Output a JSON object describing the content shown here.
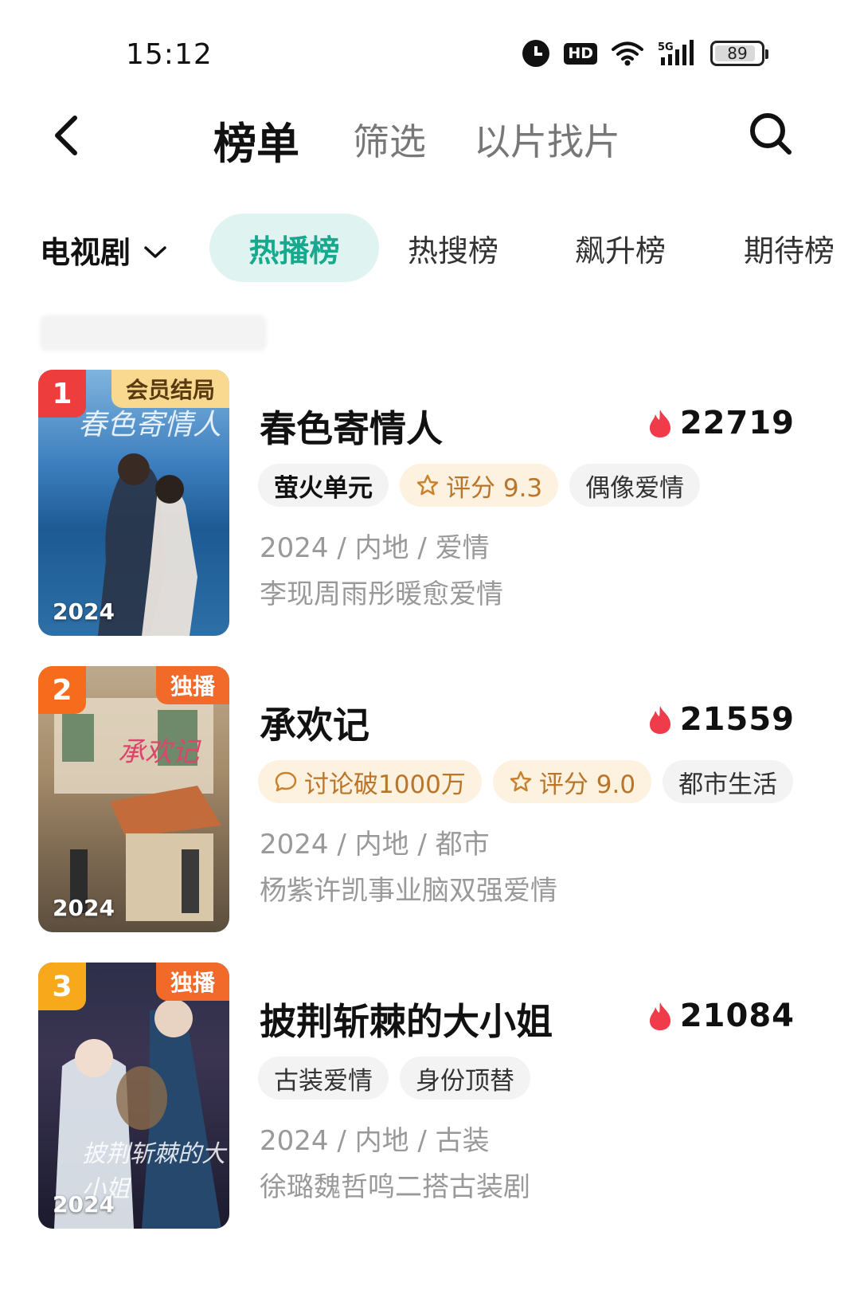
{
  "status_bar": {
    "time": "15:12",
    "battery": "89",
    "battery_level": 0.89,
    "icons": [
      "alarm-icon",
      "hd-icon",
      "wifi-icon",
      "signal-5g-icon",
      "battery-icon"
    ],
    "hd_label": "HD",
    "network_label": "5G"
  },
  "header": {
    "tab_active": "榜单",
    "tab_filter": "筛选",
    "tab_image_search": "以片找片",
    "back_icon": "chevron-left-icon",
    "search_icon": "search-icon"
  },
  "category": {
    "selected": "电视剧",
    "pills": [
      "热播榜",
      "热搜榜",
      "飙升榜",
      "期待榜"
    ],
    "active_index": 0
  },
  "colors": {
    "accent": "#17a98e",
    "accent_bg": "#dff4f1",
    "heat": "#ef3b4a",
    "warm_tag_bg": "#fdf1df",
    "warm_tag_text": "#b9762a",
    "rank1": "#ee3d3d",
    "rank2": "#f76b1c",
    "rank3": "#f7a81b"
  },
  "items": [
    {
      "rank": "1",
      "corner_tag": "会员结局",
      "poster_year": "2024",
      "title": "春色寄情人",
      "heat": "22719",
      "tags": [
        {
          "label": "萤火单元",
          "style": "brand"
        },
        {
          "label": "评分 9.3",
          "style": "warm",
          "icon": "star-icon"
        },
        {
          "label": "偶像爱情",
          "style": "plain"
        }
      ],
      "meta": "2024 / 内地 / 爱情",
      "desc": "李现周雨彤暖愈爱情"
    },
    {
      "rank": "2",
      "corner_tag": "独播",
      "poster_year": "2024",
      "title": "承欢记",
      "heat": "21559",
      "tags": [
        {
          "label": "讨论破1000万",
          "style": "warm",
          "icon": "comment-icon"
        },
        {
          "label": "评分 9.0",
          "style": "warm",
          "icon": "star-icon"
        },
        {
          "label": "都市生活",
          "style": "plain"
        }
      ],
      "meta": "2024 / 内地 / 都市",
      "desc": "杨紫许凯事业脑双强爱情"
    },
    {
      "rank": "3",
      "corner_tag": "独播",
      "poster_year": "2024",
      "title": "披荆斩棘的大小姐",
      "heat": "21084",
      "tags": [
        {
          "label": "古装爱情",
          "style": "plain"
        },
        {
          "label": "身份顶替",
          "style": "plain"
        }
      ],
      "meta": "2024 / 内地 / 古装",
      "desc": "徐璐魏哲鸣二搭古装剧"
    }
  ]
}
